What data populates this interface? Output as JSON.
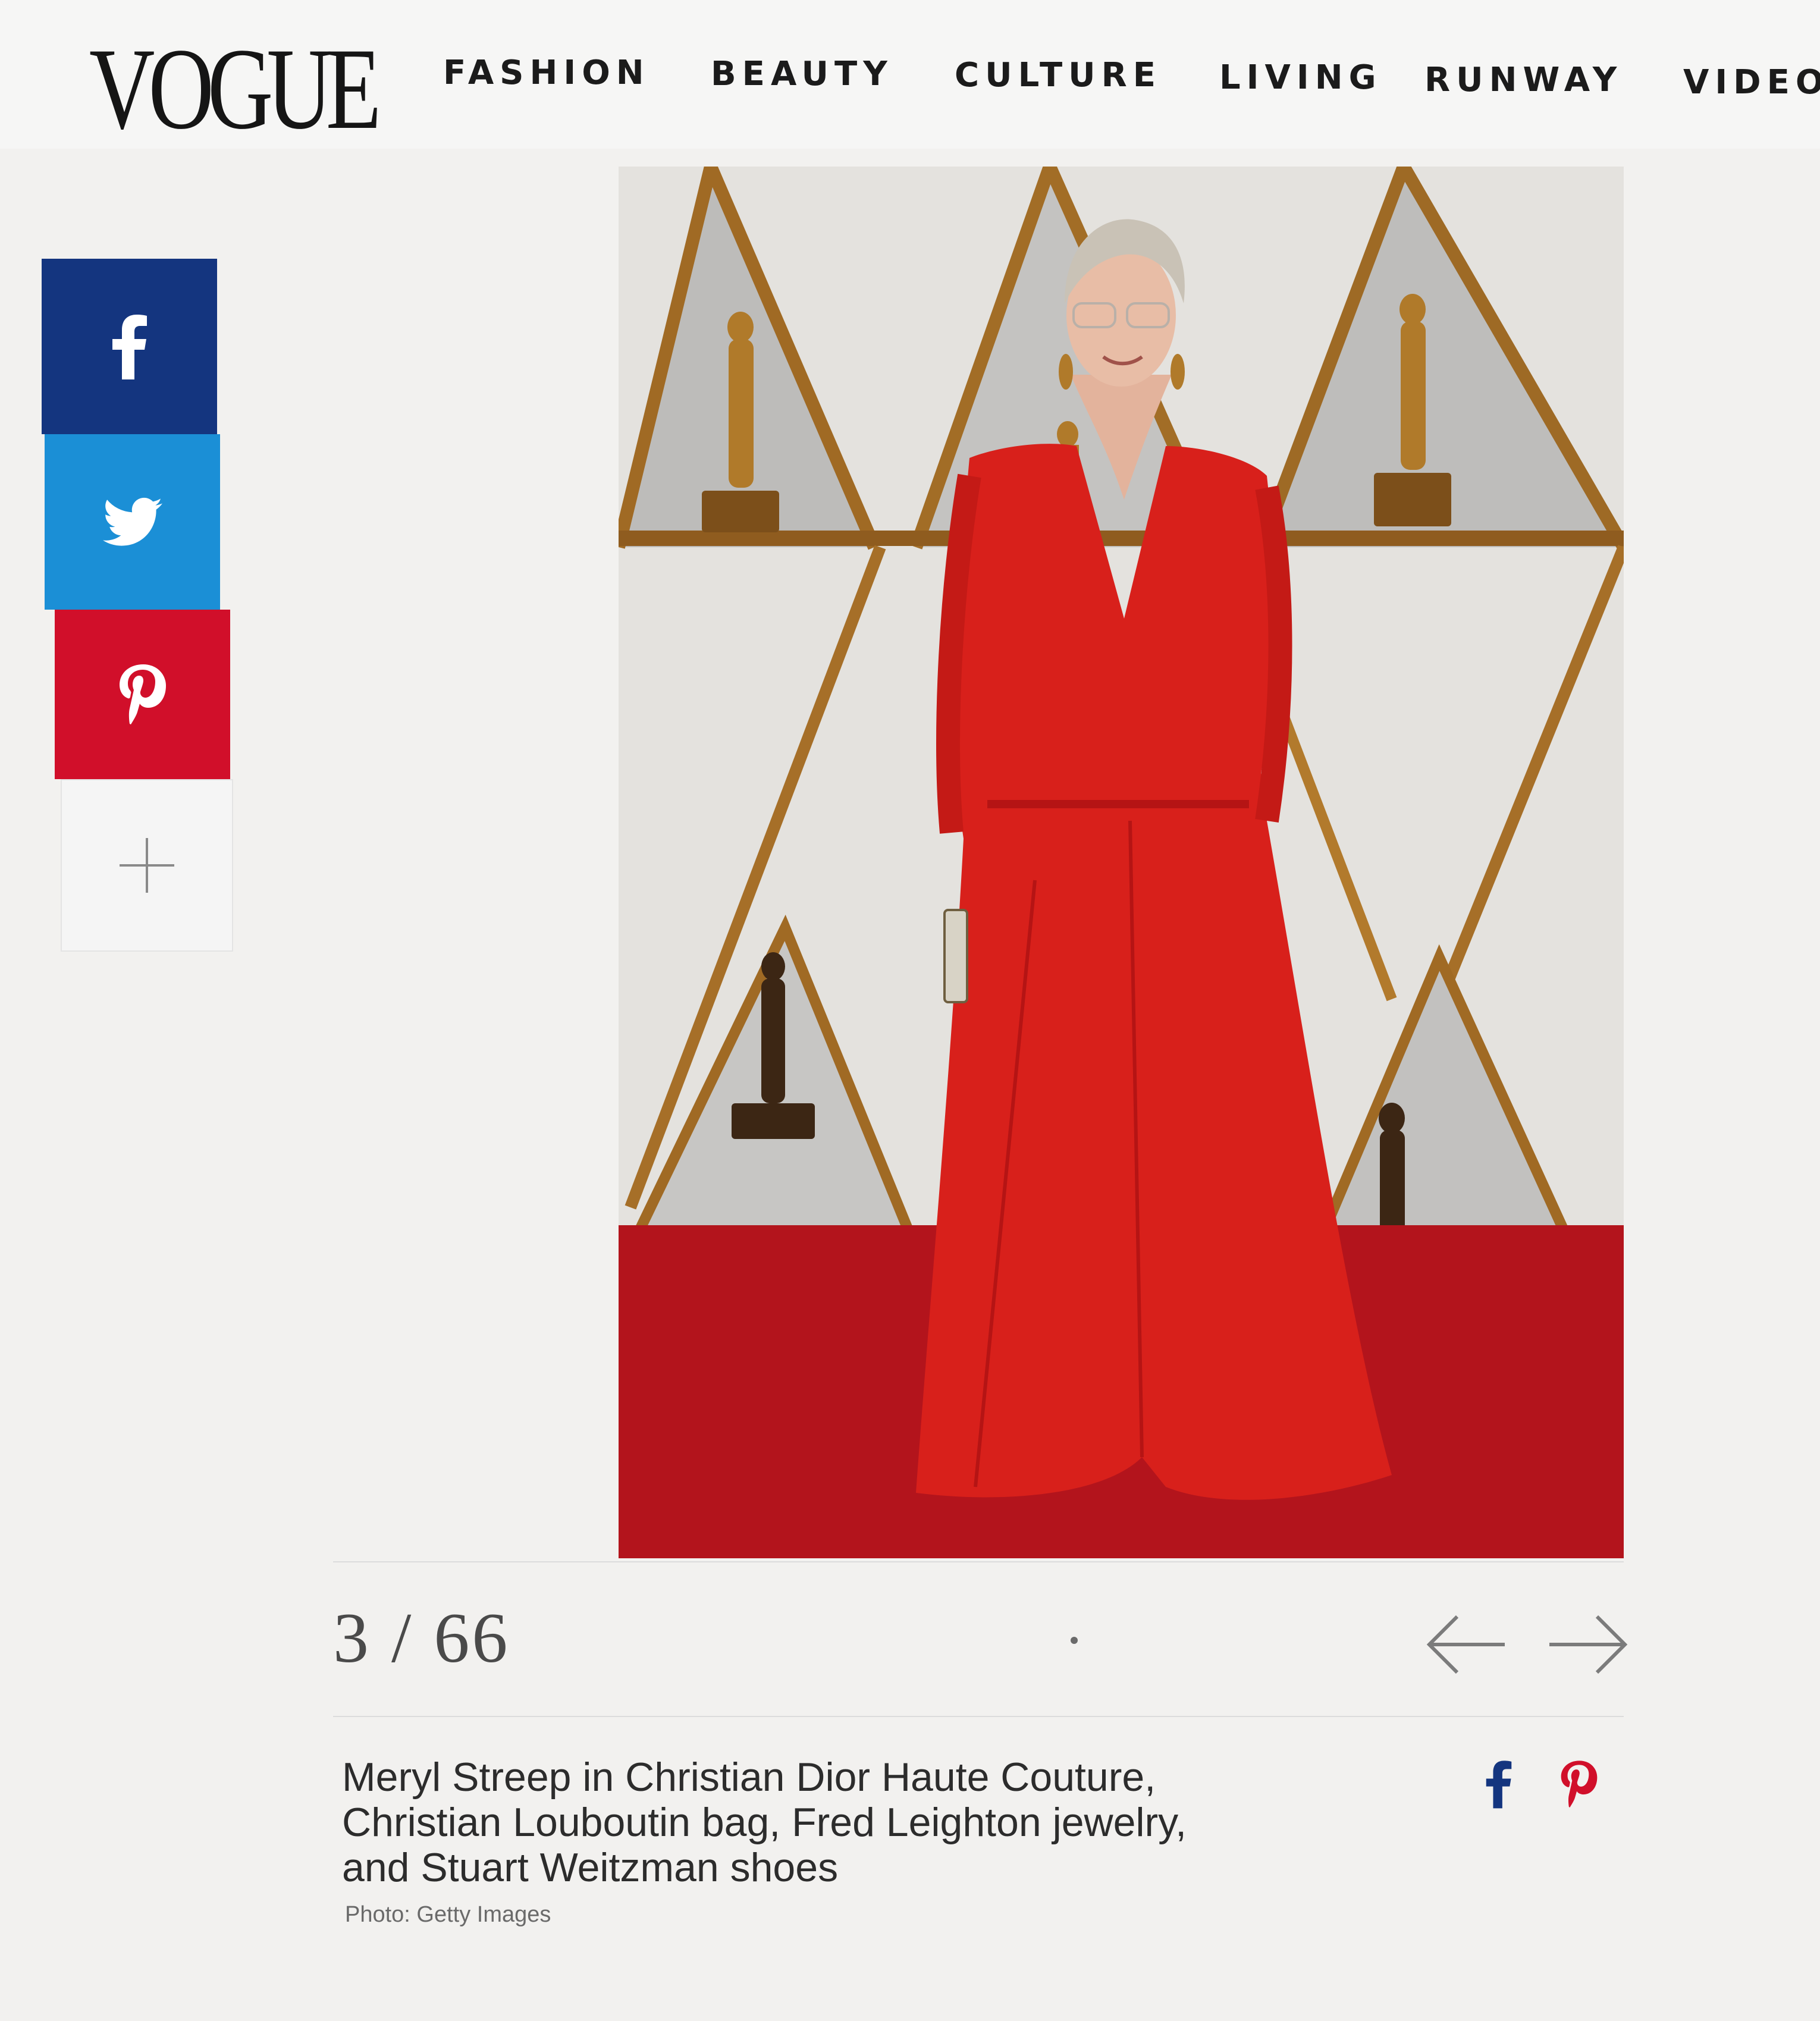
{
  "header": {
    "logo": "VOGUE",
    "nav": [
      "FASHION",
      "BEAUTY",
      "CULTURE",
      "LIVING",
      "RUNWAY",
      "VIDEO"
    ]
  },
  "share": {
    "icons": [
      "facebook-icon",
      "twitter-icon",
      "pinterest-icon",
      "plus-icon"
    ],
    "colors": {
      "facebook": "#14357f",
      "twitter": "#1b8fd6",
      "pinterest": "#d10f2a"
    }
  },
  "gallery": {
    "counter": "3 / 66",
    "caption_lines": [
      "Meryl Streep in Christian Dior Haute Couture,",
      "Christian Louboutin bag, Fred Leighton jewelry,",
      "and Stuart Weitzman shoes"
    ],
    "credit": "Photo: Getty Images",
    "colors": {
      "gown": "#d8201b",
      "carpet": "#b3141c",
      "gold": "#b07a2a"
    }
  }
}
